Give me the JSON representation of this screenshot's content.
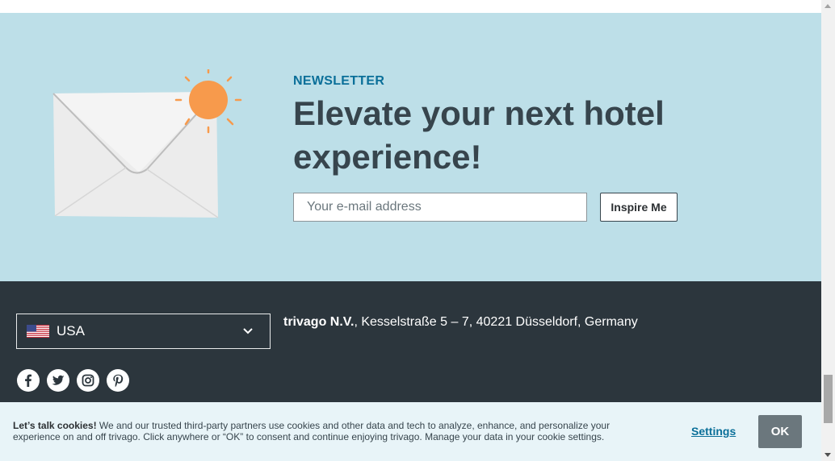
{
  "newsletter": {
    "kicker": "NEWSLETTER",
    "title": "Elevate your next hotel experience!",
    "email_placeholder": "Your e-mail address",
    "button_label": "Inspire Me"
  },
  "footer": {
    "country": "USA",
    "company_name": "trivago N.V.",
    "address": ", Kesselstraße 5 – 7, 40221 Düsseldorf, Germany",
    "socials": [
      "facebook-icon",
      "twitter-icon",
      "instagram-icon",
      "pinterest-icon"
    ]
  },
  "cookie": {
    "heading": "Let’s talk cookies!",
    "body": " We and our trusted third-party partners use cookies and other data and tech to analyze, enhance, and personalize your experience on and off trivago. Click anywhere or “OK” to consent and continue enjoying trivago. Manage your data in your cookie settings.",
    "settings_label": "Settings",
    "ok_label": "OK"
  },
  "colors": {
    "newsletter_bg": "#bddfe8",
    "footer_bg": "#2c363d",
    "accent_blue": "#0a6f99",
    "sun_orange": "#f79a4c",
    "ok_button": "#6b777d"
  }
}
